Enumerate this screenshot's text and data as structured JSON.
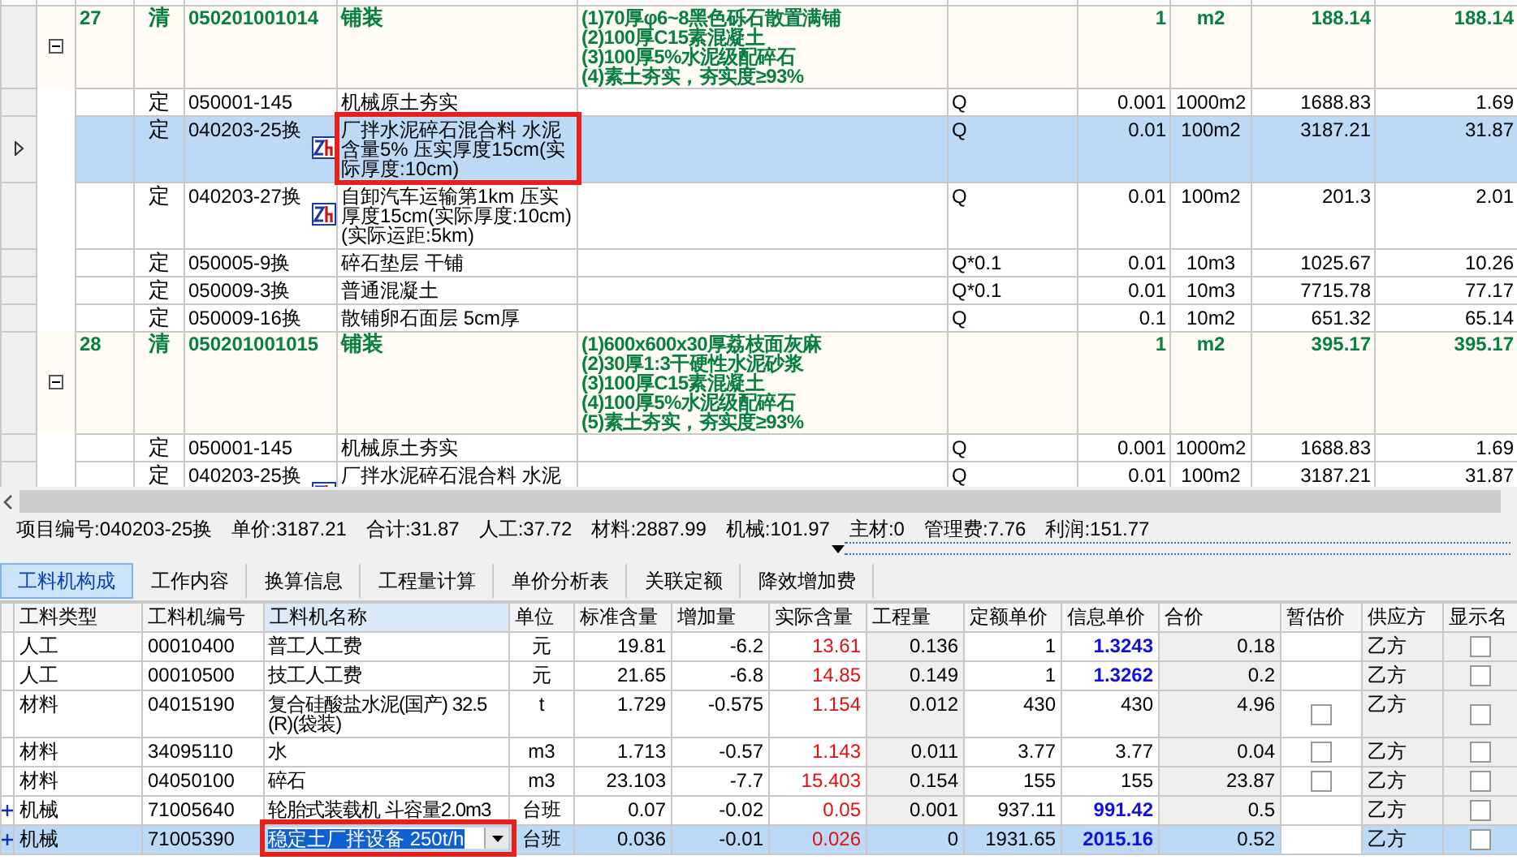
{
  "top_grid": {
    "rows": [
      {
        "kind": "bill",
        "number": "27",
        "type": "清",
        "code": "050201001014",
        "name": "铺装",
        "description": [
          "(1)70厚φ6~8黑色砾石散置满铺",
          "(2)100厚C15素混凝土",
          "(3)100厚5%水泥级配碎石",
          "(4)素土夯实，夯实度≥93%"
        ],
        "qty": "1",
        "unit": "m2",
        "price": "188.14",
        "total": "188.14",
        "expanded": true,
        "children": [
          {
            "type": "定",
            "code": "050001-145",
            "marked": false,
            "name": "机械原土夯实",
            "expression": "Q",
            "qty": "0.001",
            "unit": "1000m2",
            "price": "1688.83",
            "total": "1.69",
            "selected": false,
            "highlighted": false
          },
          {
            "type": "定",
            "code": "040203-25换",
            "marked": true,
            "name": "厂拌水泥碎石混合料 水泥含量5% 压实厚度15cm(实际厚度:10cm)",
            "expression": "Q",
            "qty": "0.01",
            "unit": "100m2",
            "price": "3187.21",
            "total": "31.87",
            "selected": true,
            "highlighted": true
          },
          {
            "type": "定",
            "code": "040203-27换",
            "marked": true,
            "name": "自卸汽车运输第1km 压实厚度15cm(实际厚度:10cm)(实际运距:5km)",
            "expression": "Q",
            "qty": "0.01",
            "unit": "100m2",
            "price": "201.3",
            "total": "2.01",
            "selected": false,
            "highlighted": false
          },
          {
            "type": "定",
            "code": "050005-9换",
            "marked": false,
            "name": "碎石垫层 干铺",
            "expression": "Q*0.1",
            "qty": "0.01",
            "unit": "10m3",
            "price": "1025.67",
            "total": "10.26",
            "selected": false,
            "highlighted": false
          },
          {
            "type": "定",
            "code": "050009-3换",
            "marked": false,
            "name": "普通混凝土",
            "expression": "Q*0.1",
            "qty": "0.01",
            "unit": "10m3",
            "price": "7715.78",
            "total": "77.17",
            "selected": false,
            "highlighted": false
          },
          {
            "type": "定",
            "code": "050009-16换",
            "marked": false,
            "name": "散铺卵石面层 5cm厚",
            "expression": "Q",
            "qty": "0.1",
            "unit": "10m2",
            "price": "651.32",
            "total": "65.14",
            "selected": false,
            "highlighted": false
          }
        ]
      },
      {
        "kind": "bill",
        "number": "28",
        "type": "清",
        "code": "050201001015",
        "name": "铺装",
        "description": [
          "(1)600x600x30厚荔枝面灰麻",
          "(2)30厚1:3干硬性水泥砂浆",
          "(3)100厚C15素混凝土",
          "(4)100厚5%水泥级配碎石",
          "(5)素土夯实，夯实度≥93%"
        ],
        "qty": "1",
        "unit": "m2",
        "price": "395.17",
        "total": "395.17",
        "expanded": true,
        "children": [
          {
            "type": "定",
            "code": "050001-145",
            "marked": false,
            "name": "机械原土夯实",
            "expression": "Q",
            "qty": "0.001",
            "unit": "1000m2",
            "price": "1688.83",
            "total": "1.69",
            "selected": false,
            "highlighted": false
          },
          {
            "type": "定",
            "code": "040203-25换",
            "marked": true,
            "name": "厂拌水泥碎石混合料 水泥",
            "expression": "Q",
            "qty": "0.01",
            "unit": "100m2",
            "price": "3187.21",
            "total": "31.87",
            "selected": false,
            "highlighted": false
          }
        ]
      }
    ]
  },
  "info_bar": [
    "项目编号:040203-25换",
    "单价:3187.21",
    "合计:31.87",
    "人工:37.72",
    "材料:2887.99",
    "机械:101.97",
    "主材:0",
    "管理费:7.76",
    "利润:151.77"
  ],
  "tabs": [
    {
      "label": "工料机构成",
      "selected": true
    },
    {
      "label": "工作内容",
      "selected": false
    },
    {
      "label": "换算信息",
      "selected": false
    },
    {
      "label": "工程量计算",
      "selected": false
    },
    {
      "label": "单价分析表",
      "selected": false
    },
    {
      "label": "关联定额",
      "selected": false
    },
    {
      "label": "降效增加费",
      "selected": false
    }
  ],
  "detail_grid": {
    "columns": [
      "工料类型",
      "工料机编号",
      "工料机名称",
      "单位",
      "标准含量",
      "增加量",
      "实际含量",
      "工程量",
      "定额单价",
      "信息单价",
      "合价",
      "暂估价",
      "供应方",
      "显示名"
    ],
    "rows": [
      {
        "type": "人工",
        "code": "00010400",
        "name": "普工人工费",
        "unit": "元",
        "std_qty": "19.81",
        "add_qty": "-6.2",
        "actual_qty": "13.61",
        "work_qty": "0.136",
        "quota_price": "1",
        "info_price": "1.3243",
        "info_adjusted": true,
        "total": "0.18",
        "supplier": "乙方",
        "show_name": false,
        "expandable": false,
        "selected": false,
        "highlighted": false
      },
      {
        "type": "人工",
        "code": "00010500",
        "name": "技工人工费",
        "unit": "元",
        "std_qty": "21.65",
        "add_qty": "-6.8",
        "actual_qty": "14.85",
        "work_qty": "0.149",
        "quota_price": "1",
        "info_price": "1.3262",
        "info_adjusted": true,
        "total": "0.2",
        "supplier": "乙方",
        "show_name": false,
        "expandable": false,
        "selected": false,
        "highlighted": false
      },
      {
        "type": "材料",
        "code": "04015190",
        "name": "复合硅酸盐水泥(国产) 32.5(R)(袋装)",
        "unit": "t",
        "std_qty": "1.729",
        "add_qty": "-0.575",
        "actual_qty": "1.154",
        "work_qty": "0.012",
        "quota_price": "430",
        "info_price": "430",
        "info_adjusted": false,
        "total": "4.96",
        "estimate": false,
        "supplier": "乙方",
        "show_name": false,
        "expandable": false,
        "selected": false,
        "highlighted": false
      },
      {
        "type": "材料",
        "code": "34095110",
        "name": "水",
        "unit": "m3",
        "std_qty": "1.713",
        "add_qty": "-0.57",
        "actual_qty": "1.143",
        "work_qty": "0.011",
        "quota_price": "3.77",
        "info_price": "3.77",
        "info_adjusted": false,
        "total": "0.04",
        "estimate": false,
        "supplier": "乙方",
        "show_name": false,
        "expandable": false,
        "selected": false,
        "highlighted": false
      },
      {
        "type": "材料",
        "code": "04050100",
        "name": "碎石",
        "unit": "m3",
        "std_qty": "23.103",
        "add_qty": "-7.7",
        "actual_qty": "15.403",
        "work_qty": "0.154",
        "quota_price": "155",
        "info_price": "155",
        "info_adjusted": false,
        "total": "23.87",
        "estimate": false,
        "supplier": "乙方",
        "show_name": false,
        "expandable": false,
        "selected": false,
        "highlighted": false
      },
      {
        "type": "机械",
        "code": "71005640",
        "name": "轮胎式装载机 斗容量2.0m3",
        "unit": "台班",
        "std_qty": "0.07",
        "add_qty": "-0.02",
        "actual_qty": "0.05",
        "work_qty": "0.001",
        "quota_price": "937.11",
        "info_price": "991.42",
        "info_adjusted": true,
        "total": "0.5",
        "supplier": "乙方",
        "show_name": false,
        "expandable": true,
        "selected": false,
        "highlighted": false
      },
      {
        "type": "机械",
        "code": "71005390",
        "name": "稳定土厂拌设备 250t/h",
        "unit": "台班",
        "std_qty": "0.036",
        "add_qty": "-0.01",
        "actual_qty": "0.026",
        "work_qty": "0",
        "quota_price": "1931.65",
        "info_price": "2015.16",
        "info_adjusted": true,
        "total": "0.52",
        "supplier": "乙方",
        "show_name": false,
        "expandable": true,
        "selected": true,
        "highlighted": true
      }
    ]
  }
}
